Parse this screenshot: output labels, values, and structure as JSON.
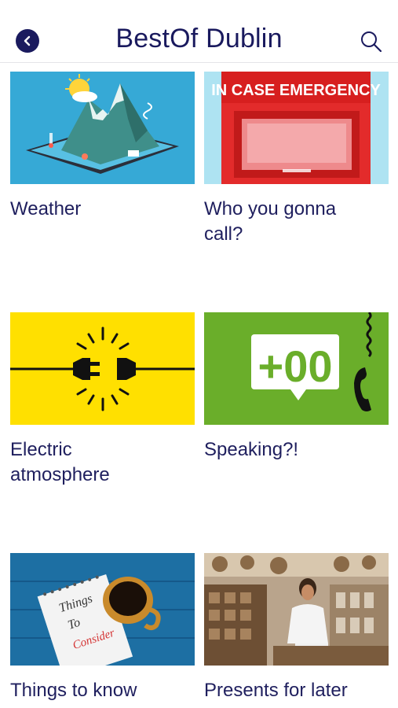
{
  "header": {
    "title": "BestOf Dublin"
  },
  "tiles": [
    {
      "label": "Weather",
      "image_icon": "weather-illustration"
    },
    {
      "label": "Who you gonna call?",
      "image_icon": "emergency-box-illustration",
      "image_text": "IN CASE EMERGENCY"
    },
    {
      "label": "Electric atmosphere",
      "image_icon": "electric-plug-illustration"
    },
    {
      "label": "Speaking?!",
      "image_icon": "phone-country-code-illustration",
      "image_text": "+00"
    },
    {
      "label": "Things to know",
      "image_icon": "notebook-coffee-photo",
      "image_text_lines": [
        "Things",
        "To",
        "Consider"
      ]
    },
    {
      "label": "Presents for later",
      "image_icon": "market-shopping-photo"
    }
  ],
  "colors": {
    "brand": "#1a1a5e",
    "weather_bg": "#36a9d6",
    "emergency_red": "#e32b2b",
    "electric_yellow": "#ffe000",
    "speaking_green": "#6aae2a",
    "wood_blue": "#1d6fa3"
  }
}
